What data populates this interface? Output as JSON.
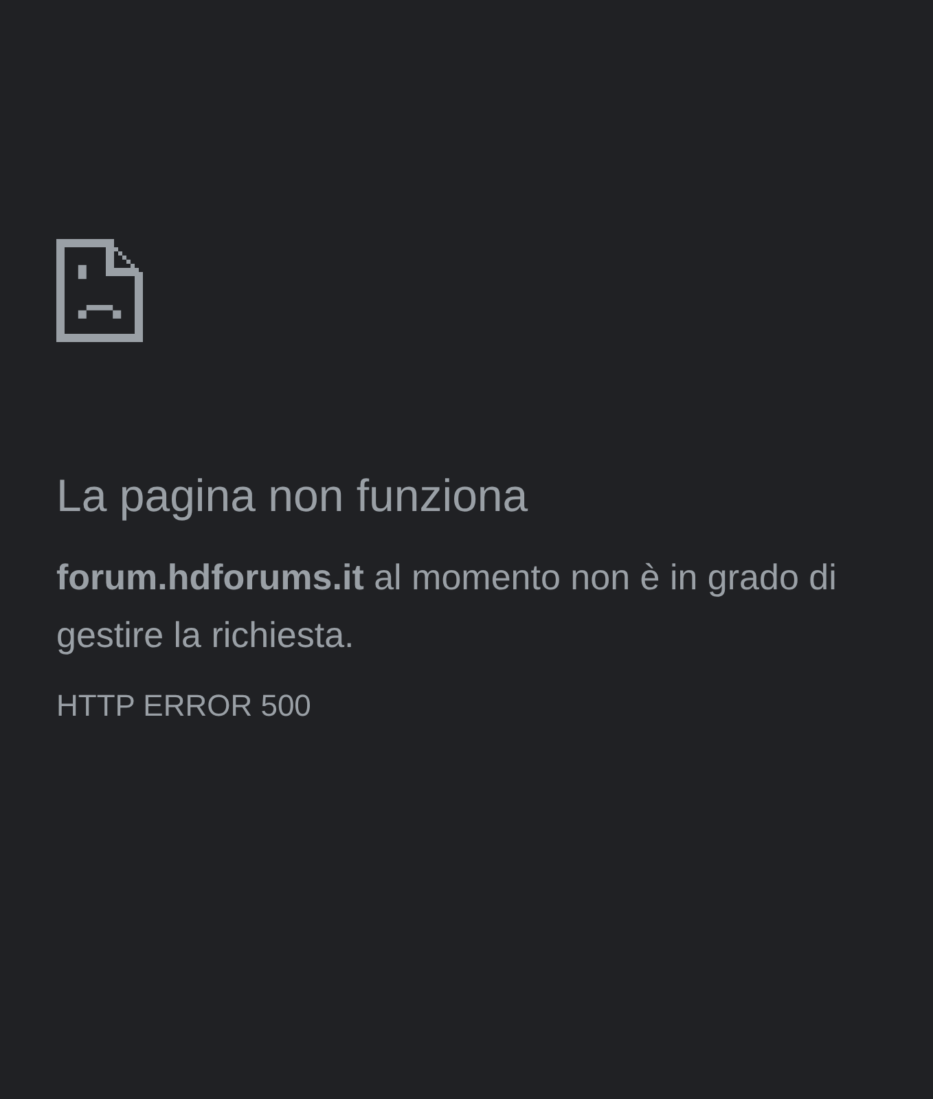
{
  "title": "La pagina non funziona",
  "message": "**forum.hdforums.it** al momento non è in grado di gestire la richiesta.",
  "error_code": "HTTP ERROR 500"
}
